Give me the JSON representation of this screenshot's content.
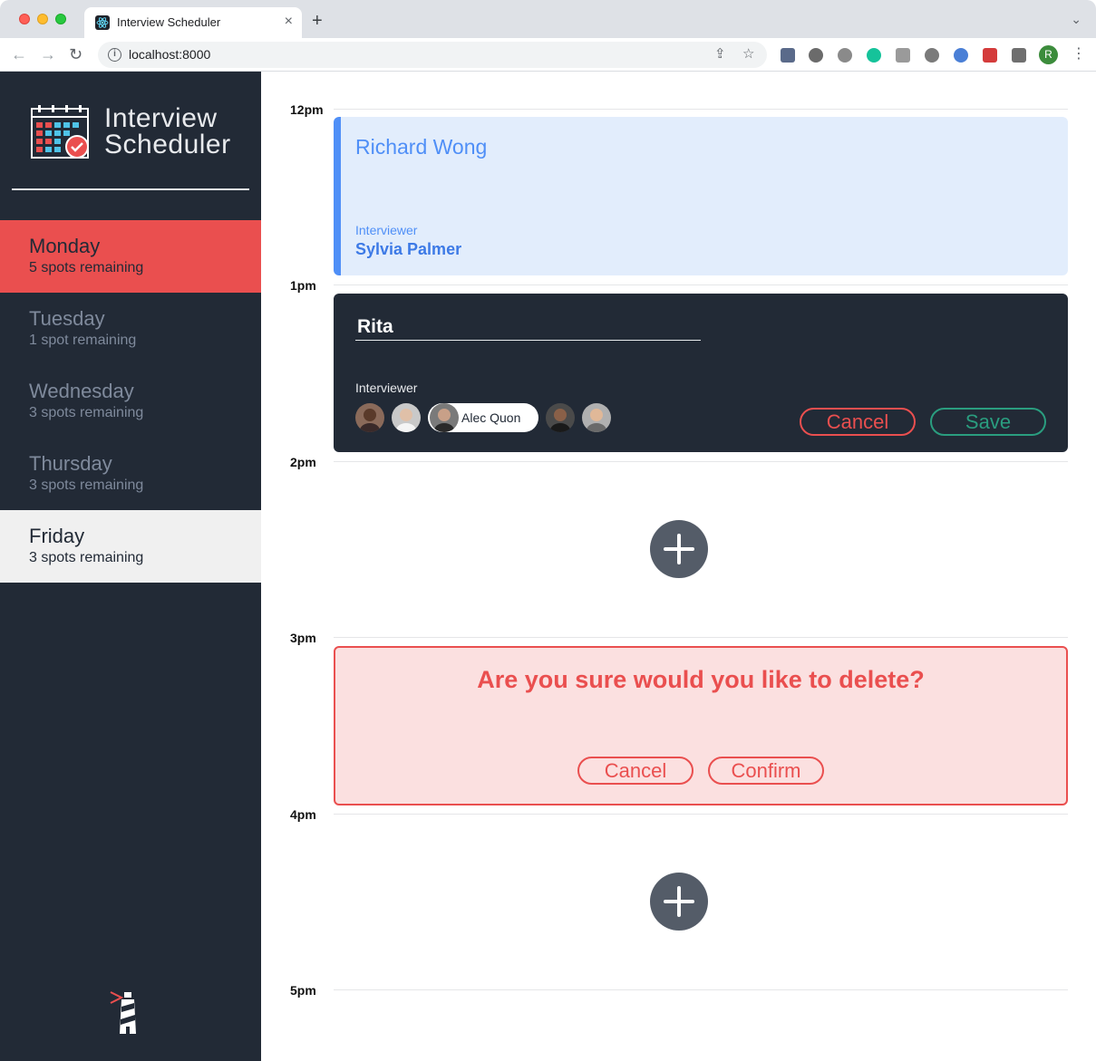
{
  "browser": {
    "tab_title": "Interview Scheduler",
    "tab_close": "×",
    "new_tab": "+",
    "url": "localhost:8000",
    "profile_initial": "R"
  },
  "sidebar": {
    "logo_line1": "Interview",
    "logo_line2": "Scheduler",
    "days": [
      {
        "name": "Monday",
        "spots": "5 spots remaining",
        "state": "selected"
      },
      {
        "name": "Tuesday",
        "spots": "1 spot remaining",
        "state": "default"
      },
      {
        "name": "Wednesday",
        "spots": "3 spots remaining",
        "state": "default"
      },
      {
        "name": "Thursday",
        "spots": "3 spots remaining",
        "state": "default"
      },
      {
        "name": "Friday",
        "spots": "3 spots remaining",
        "state": "full"
      }
    ]
  },
  "schedule": {
    "hours": [
      "12pm",
      "1pm",
      "2pm",
      "3pm",
      "4pm",
      "5pm"
    ],
    "show": {
      "student": "Richard Wong",
      "interviewer_label": "Interviewer",
      "interviewer": "Sylvia Palmer"
    },
    "form": {
      "student_value": "Rita",
      "interviewer_label": "Interviewer",
      "selected_interviewer": "Alec Quon",
      "cancel_label": "Cancel",
      "save_label": "Save"
    },
    "confirm": {
      "message": "Are you sure would you like to delete?",
      "cancel_label": "Cancel",
      "confirm_label": "Confirm"
    }
  },
  "colors": {
    "sidebar_bg": "#222a36",
    "selected_day": "#ea4f4f",
    "show_accent": "#4f8ff7",
    "confirm_green": "#2a9d7f",
    "danger_red": "#ea4f4f"
  }
}
